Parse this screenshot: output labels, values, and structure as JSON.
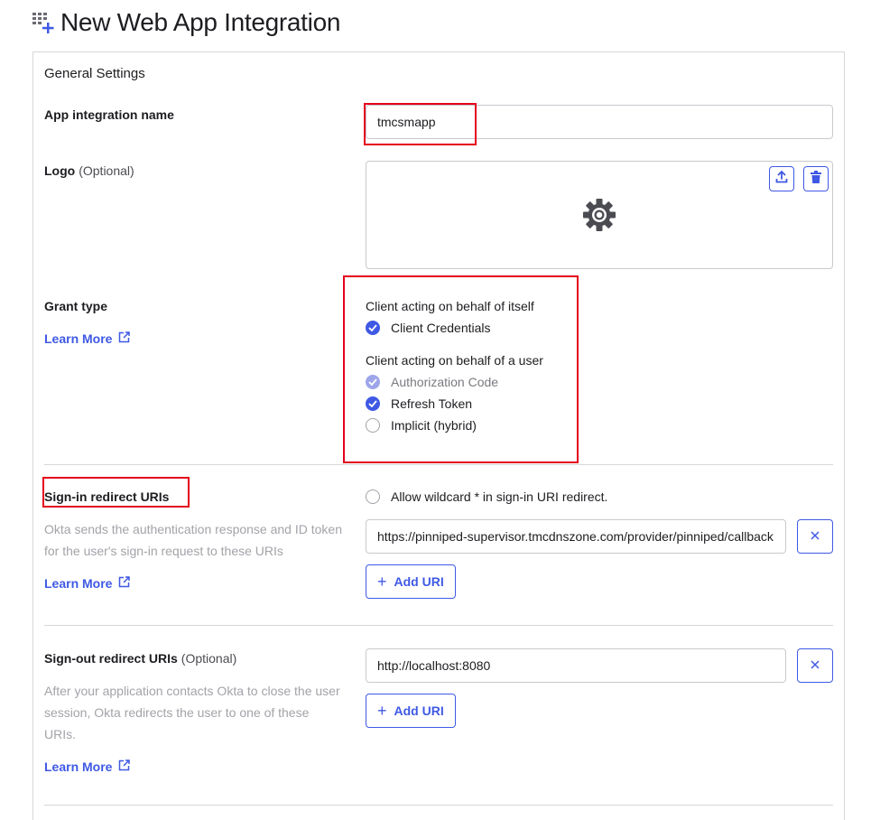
{
  "header": {
    "title": "New Web App Integration"
  },
  "general": {
    "title": "General Settings",
    "app_name": {
      "label": "App integration name",
      "value": "tmcsmapp"
    },
    "logo": {
      "label": "Logo",
      "optional": "(Optional)"
    }
  },
  "grant": {
    "label": "Grant type",
    "learn_more": "Learn More",
    "self_heading": "Client acting on behalf of itself",
    "user_heading": "Client acting on behalf of a user",
    "options": [
      {
        "label": "Client Credentials",
        "state": "checked"
      },
      {
        "label": "Authorization Code",
        "state": "checked-disabled"
      },
      {
        "label": "Refresh Token",
        "state": "checked"
      },
      {
        "label": "Implicit (hybrid)",
        "state": "unchecked"
      }
    ]
  },
  "signin": {
    "label": "Sign-in redirect URIs",
    "description": "Okta sends the authentication response and ID token for the user's sign-in request to these URIs",
    "learn_more": "Learn More",
    "wildcard_label": "Allow wildcard * in sign-in URI redirect.",
    "uri_value": "https://pinniped-supervisor.tmcdnszone.com/provider/pinniped/callback",
    "add_label": "Add URI"
  },
  "signout": {
    "label": "Sign-out redirect URIs",
    "optional": "(Optional)",
    "description": "After your application contacts Okta to close the user session, Okta redirects the user to one of these URIs.",
    "learn_more": "Learn More",
    "uri_value": "http://localhost:8080",
    "add_label": "Add URI"
  },
  "colors": {
    "accent": "#3f59e4",
    "highlight": "#e4001b",
    "muted": "#a3a3a9"
  }
}
